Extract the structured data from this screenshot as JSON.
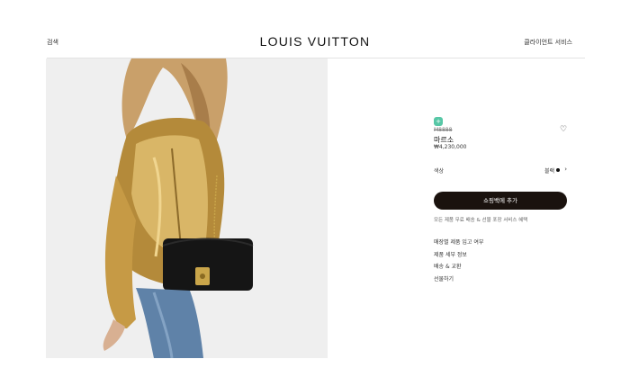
{
  "header": {
    "search_label": "검색",
    "brand": "LOUIS VUITTON",
    "client_service_label": "클라이언트 서비스"
  },
  "product": {
    "badge": "+",
    "sku": "M8888",
    "name": "마르소",
    "price": "₩4,230,000",
    "color_label": "색상",
    "color_value": "블랙",
    "swatch_color": "#111111",
    "add_to_cart_label": "쇼핑백에 추가",
    "service_note": "모든 제품 무료 배송 & 선물 포장 서비스 혜택",
    "links": [
      "매장별 제품 입고 여부",
      "제품 세부 정보",
      "배송 & 교환",
      "선물하기"
    ]
  },
  "colors": {
    "cart_button": "#1a120e",
    "badge": "#57c7a6"
  }
}
